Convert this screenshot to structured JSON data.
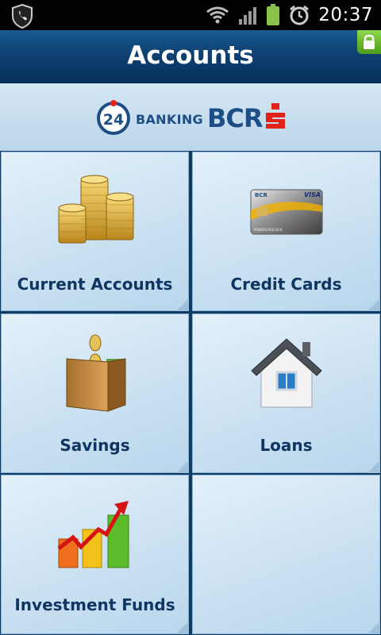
{
  "status_bar": {
    "time": "20:37",
    "icons": [
      "security-shield-icon",
      "wifi-icon",
      "signal-icon",
      "battery-icon",
      "alarm-icon"
    ]
  },
  "header": {
    "title": "Accounts",
    "lock_icon": "lock-icon"
  },
  "branding": {
    "badge_number": "24",
    "badge_label": "BANKING",
    "bank_name": "BCR",
    "colors": {
      "brand_blue": "#1d4f86",
      "brand_red": "#e2231a"
    }
  },
  "tiles": [
    {
      "label": "Current Accounts",
      "icon": "coins-icon"
    },
    {
      "label": "Credit Cards",
      "icon": "credit-card-icon"
    },
    {
      "label": "Savings",
      "icon": "wallet-icon"
    },
    {
      "label": "Loans",
      "icon": "house-icon"
    },
    {
      "label": "Investment Funds",
      "icon": "growth-chart-icon"
    },
    {
      "label": "",
      "icon": ""
    }
  ],
  "card_art": {
    "brand": "BCR",
    "network": "VISA",
    "caption": "POWERCARD BCR"
  }
}
